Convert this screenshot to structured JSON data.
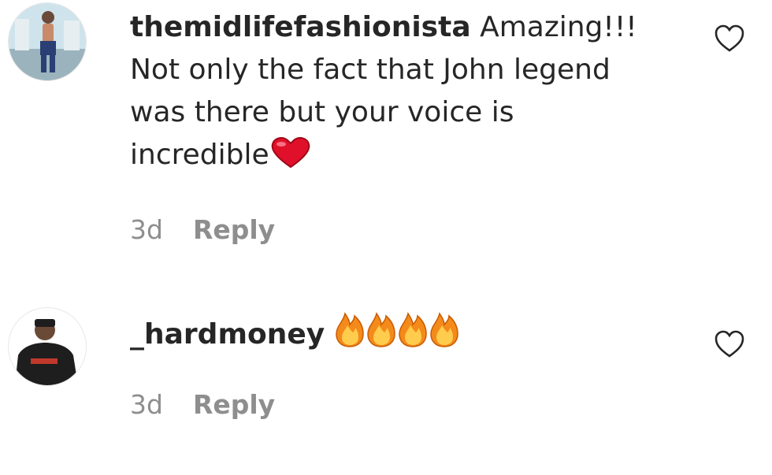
{
  "comments": [
    {
      "username": "themidlifefashionista",
      "text": "Amazing!!! Not only the fact that John legend was there but your voice is incredible",
      "emoji": "red-heart",
      "time": "3d",
      "reply_label": "Reply",
      "like_icon": "heart-outline-icon"
    },
    {
      "username": "_hardmoney",
      "text": "",
      "emoji": "fire x4",
      "time": "3d",
      "reply_label": "Reply",
      "like_icon": "heart-outline-icon"
    }
  ],
  "colors": {
    "text": "#262626",
    "secondary": "#8e8e8e",
    "heart_emoji": "#e0102a",
    "fire_outer": "#f48a1a",
    "fire_inner": "#ffcc4d"
  }
}
